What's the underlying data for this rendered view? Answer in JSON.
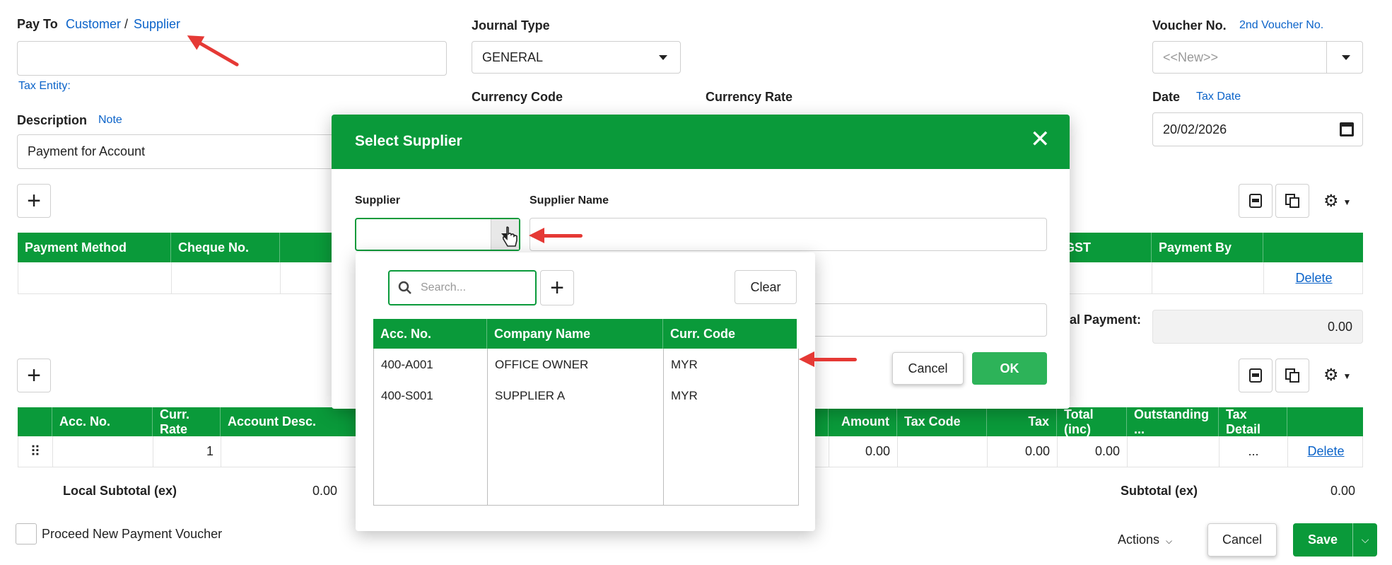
{
  "pay_to": {
    "label": "Pay To",
    "customer": "Customer",
    "slash": "/",
    "supplier": "Supplier",
    "tax_entity": "Tax Entity:"
  },
  "journal_type": {
    "label": "Journal Type",
    "value": "GENERAL"
  },
  "voucher_no": {
    "label": "Voucher No.",
    "second": "2nd Voucher No.",
    "placeholder": "<<New>>"
  },
  "currency_code": {
    "label": "Currency Code"
  },
  "currency_rate": {
    "label": "Currency Rate"
  },
  "date": {
    "label": "Date",
    "tax_date": "Tax Date",
    "value": "20/02/2026"
  },
  "description": {
    "label": "Description",
    "note": "Note",
    "value": "Payment for Account"
  },
  "payment_table": {
    "headers": [
      "Payment Method",
      "Cheque No.",
      "GST",
      "Payment By"
    ],
    "delete": "Delete",
    "total_label": "otal Payment:",
    "total_value": "0.00"
  },
  "detail_table": {
    "headers": [
      "Acc. No.",
      "Curr. Rate",
      "Account Desc.",
      "Amount",
      "Tax Code",
      "Tax",
      "Total (inc)",
      "Outstanding ...",
      "Tax Detail"
    ],
    "row": {
      "curr_rate": "1",
      "amount": "0.00",
      "tax": "0.00",
      "total": "0.00",
      "tax_detail": "...",
      "delete": "Delete"
    },
    "local_subtotal_label": "Local Subtotal (ex)",
    "local_subtotal_value": "0.00",
    "subtotal_label": "Subtotal (ex)",
    "subtotal_value": "0.00"
  },
  "footer": {
    "proceed": "Proceed New Payment Voucher",
    "actions": "Actions",
    "cancel": "Cancel",
    "save": "Save"
  },
  "modal": {
    "title": "Select Supplier",
    "supplier_label": "Supplier",
    "supplier_name_label": "Supplier Name",
    "cancel": "Cancel",
    "ok": "OK"
  },
  "dropdown": {
    "search_placeholder": "Search...",
    "clear": "Clear",
    "headers": [
      "Acc. No.",
      "Company Name",
      "Curr. Code"
    ],
    "rows": [
      {
        "acc": "400-A001",
        "name": "OFFICE OWNER",
        "curr": "MYR"
      },
      {
        "acc": "400-S001",
        "name": "SUPPLIER A",
        "curr": "MYR"
      }
    ]
  },
  "colors": {
    "green": "#0a9a3a",
    "link": "#0b63c9",
    "annotation": "#e53935"
  }
}
